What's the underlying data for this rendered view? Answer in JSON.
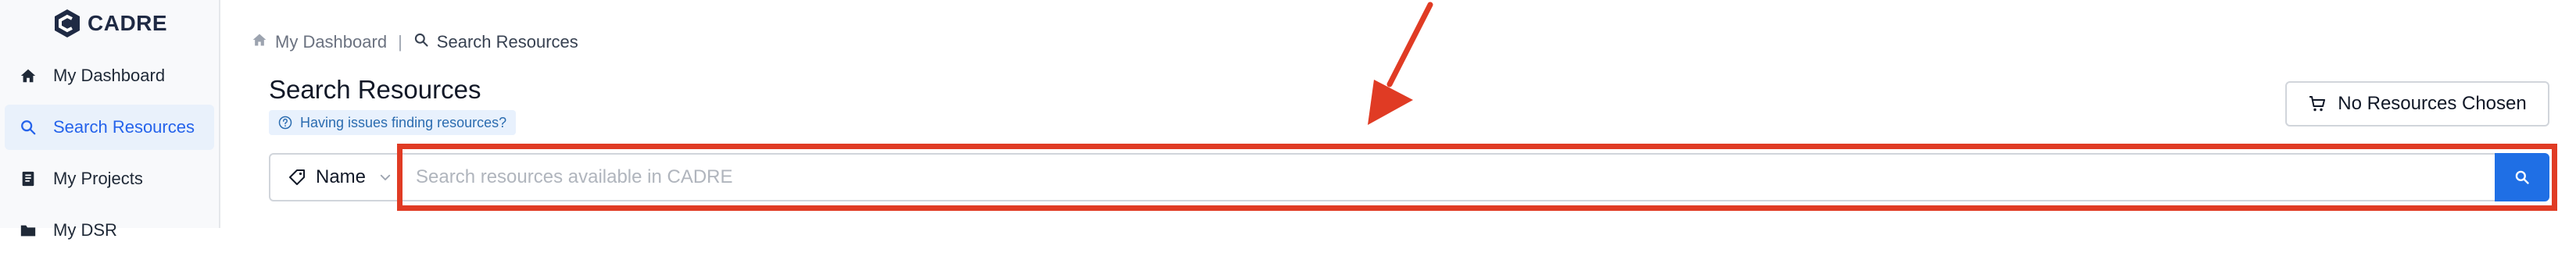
{
  "app": {
    "logo_text": "CADRE"
  },
  "sidebar": {
    "items": [
      {
        "label": "My Dashboard",
        "icon": "home-icon"
      },
      {
        "label": "Search Resources",
        "icon": "search-icon",
        "active": true
      },
      {
        "label": "My Projects",
        "icon": "book-icon"
      },
      {
        "label": "My DSR",
        "icon": "folder-icon"
      }
    ]
  },
  "breadcrumb": {
    "home": "My Dashboard",
    "separator": "|",
    "current": "Search Resources"
  },
  "main": {
    "title": "Search Resources",
    "help_link": "Having issues finding resources?",
    "cart_label": "No Resources Chosen",
    "search": {
      "field_label": "Name",
      "placeholder": "Search resources available in CADRE",
      "value": ""
    }
  },
  "colors": {
    "accent": "#1f6fe5",
    "active_bg": "#e9f1fb",
    "annotation": "#e03b24"
  }
}
